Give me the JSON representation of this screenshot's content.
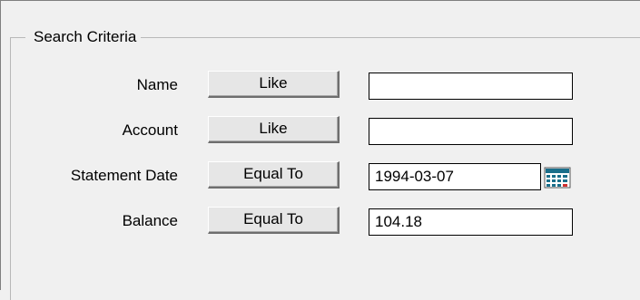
{
  "group": {
    "title": "Search Criteria"
  },
  "rows": [
    {
      "label": "Name",
      "operator": "Like",
      "value": ""
    },
    {
      "label": "Account",
      "operator": "Like",
      "value": ""
    },
    {
      "label": "Statement Date",
      "operator": "Equal To",
      "value": "1994-03-07",
      "picker_icon": "calendar-icon"
    },
    {
      "label": "Balance",
      "operator": "Equal To",
      "value": "104.18"
    }
  ],
  "colors": {
    "background": "#f0f0f0",
    "calendar_accent": "#1a6e8a"
  }
}
